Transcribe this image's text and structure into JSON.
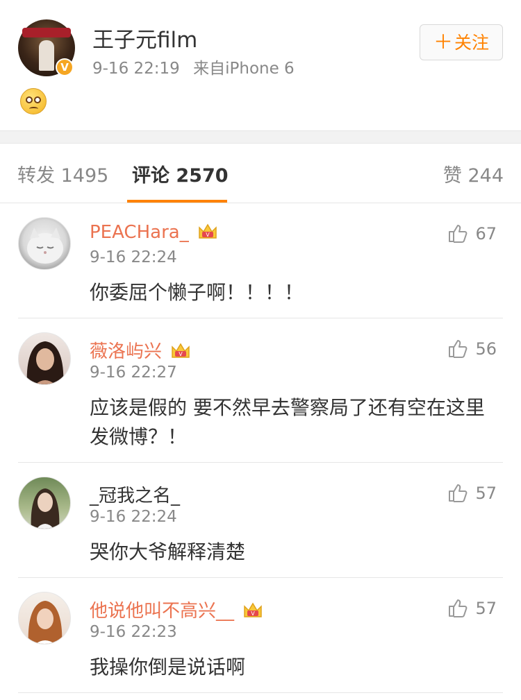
{
  "post": {
    "author": "王子元film",
    "time": "9-16 22:19",
    "source": "来自iPhone 6",
    "follow_label": "关注",
    "follow_plus": "＋",
    "verified_badge": "V",
    "content_emoji": "sad-face-emoji"
  },
  "tabs": {
    "repost": "转发 1495",
    "comment": "评论 2570",
    "like": "赞 244"
  },
  "colors": {
    "accent": "#ff8200",
    "username_vip": "#eb7350",
    "text": "#333333",
    "meta": "#888888"
  },
  "comments": [
    {
      "name": "PEACHara_",
      "vip": true,
      "time": "9-16 22:24",
      "text": "你委屈个懒子啊！！！！",
      "likes": "67"
    },
    {
      "name": "薇洛屿兴",
      "vip": true,
      "time": "9-16 22:27",
      "text": "应该是假的 要不然早去警察局了还有空在这里发微博？！",
      "likes": "56"
    },
    {
      "name": "_冠我之名_",
      "vip": false,
      "time": "9-16 22:24",
      "text": "哭你大爷解释清楚",
      "likes": "57"
    },
    {
      "name": "他说他叫不高兴__",
      "vip": true,
      "time": "9-16 22:23",
      "text": "我操你倒是说话啊",
      "likes": "57"
    }
  ]
}
